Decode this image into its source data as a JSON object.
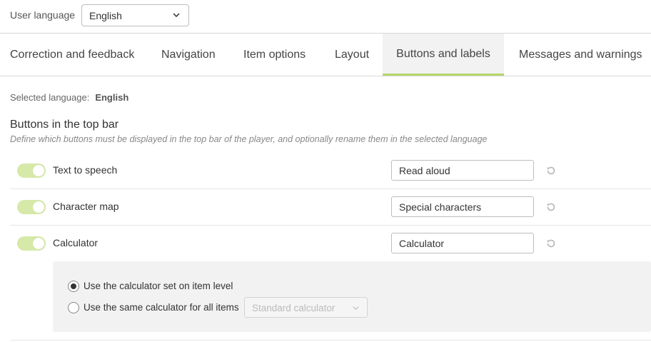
{
  "language_bar": {
    "label": "User language",
    "selected": "English"
  },
  "tabs": [
    {
      "label": "Correction and feedback",
      "active": false
    },
    {
      "label": "Navigation",
      "active": false
    },
    {
      "label": "Item options",
      "active": false
    },
    {
      "label": "Layout",
      "active": false
    },
    {
      "label": "Buttons and labels",
      "active": true
    },
    {
      "label": "Messages and warnings",
      "active": false
    }
  ],
  "selected_language": {
    "label": "Selected language:",
    "value": "English"
  },
  "section": {
    "title": "Buttons in the top bar",
    "description": "Define which buttons must be displayed in the top bar of the player, and optionally rename them in the selected language"
  },
  "buttons": [
    {
      "label": "Text to speech",
      "enabled": true,
      "value": "Read aloud"
    },
    {
      "label": "Character map",
      "enabled": true,
      "value": "Special characters"
    },
    {
      "label": "Calculator",
      "enabled": true,
      "value": "Calculator"
    }
  ],
  "calculator_options": {
    "option1": {
      "label": "Use the calculator set on item level",
      "checked": true
    },
    "option2": {
      "label": "Use the same calculator for all items",
      "checked": false
    },
    "calculator_select": {
      "value": "Standard calculator",
      "disabled": true
    }
  },
  "colors": {
    "accent": "#b5d66a",
    "toggle_on": "#d6e9a8",
    "panel_bg": "#f2f2f2"
  },
  "icons": {
    "language_dropdown": "chevron-down-icon",
    "reset": "reset-icon",
    "calculator_dropdown": "chevron-down-icon"
  }
}
